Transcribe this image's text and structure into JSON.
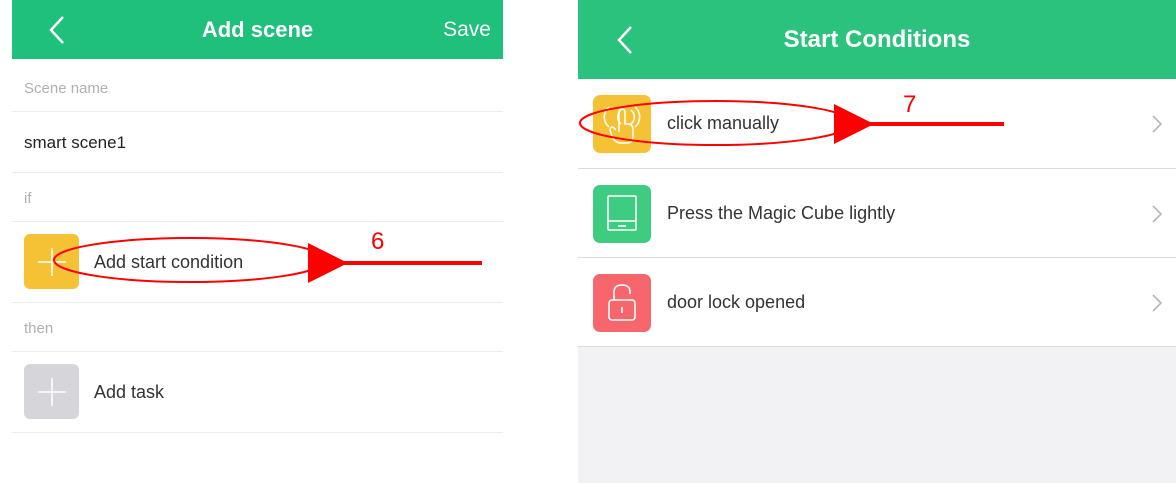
{
  "left": {
    "title": "Add scene",
    "save_label": "Save",
    "scene_name_label": "Scene name",
    "scene_name_value": "smart scene1",
    "if_label": "if",
    "add_condition_label": "Add start condition",
    "then_label": "then",
    "add_task_label": "Add task",
    "annotation": "6"
  },
  "right": {
    "title": "Start Conditions",
    "conditions": [
      {
        "label": "click manually",
        "icon": "hand-tap-icon",
        "color": "#f5c235"
      },
      {
        "label": "Press the Magic Cube lightly",
        "icon": "magic-cube-icon",
        "color": "#3ecc80"
      },
      {
        "label": "door lock opened",
        "icon": "unlock-icon",
        "color": "#f6666c"
      }
    ],
    "annotation": "7"
  },
  "colors": {
    "nav_green": "#1fbf7c",
    "yellow": "#f5c235",
    "gray_icon": "#d6d6da",
    "annotation_red": "#ff0000"
  }
}
